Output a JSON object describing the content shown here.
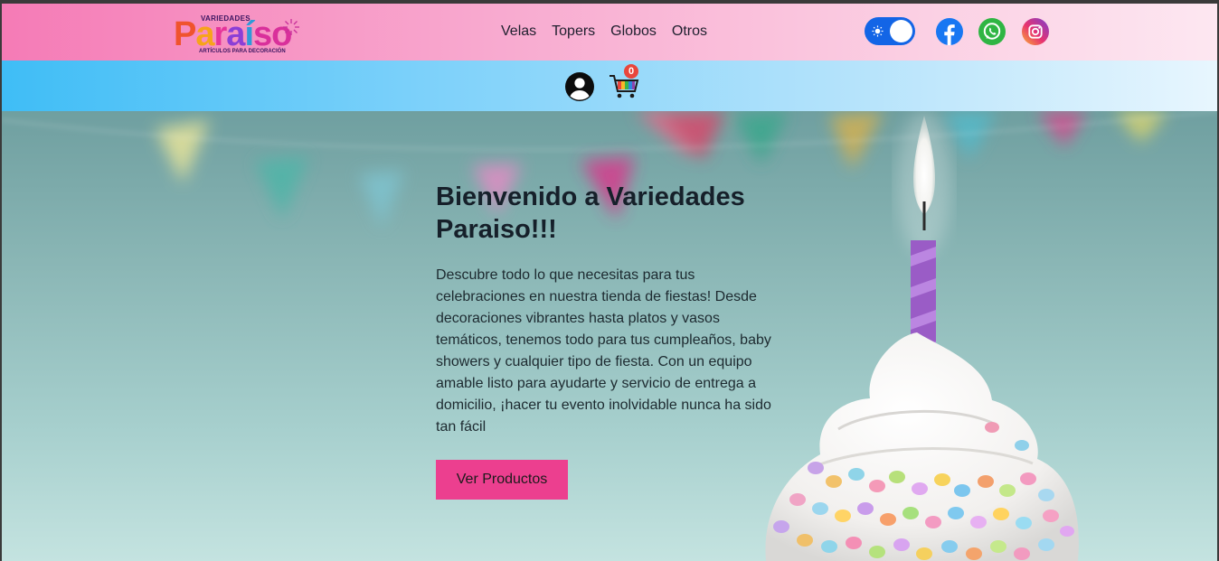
{
  "brand": {
    "top_word": "VARIEDADES",
    "letters": [
      "P",
      "a",
      "r",
      "a",
      "í",
      "so"
    ],
    "tagline": "ARTÍCULOS PARA DECORACIÓN"
  },
  "nav": {
    "items": [
      "Velas",
      "Topers",
      "Globos",
      "Otros"
    ]
  },
  "cart": {
    "count": "0"
  },
  "hero": {
    "title": "Bienvenido a Variedades Paraiso!!!",
    "text": "Descubre todo lo que necesitas para tus celebraciones en nuestra tienda de fiestas! Desde decoraciones vibrantes hasta platos y vasos temáticos, tenemos todo para tus cumpleaños, baby showers y cualquier tipo de fiesta. Con un equipo amable listo para ayudarte y servicio de entrega a domicilio, ¡hacer tu evento inolvidable nunca ha sido tan fácil",
    "button_label": "Ver Productos"
  },
  "icons": {
    "theme_toggle": "sun-icon",
    "social": [
      "facebook-icon",
      "whatsapp-icon",
      "instagram-icon"
    ],
    "user": "user-circle-icon",
    "cart": "shopping-cart-icon"
  },
  "colors": {
    "accent_pink": "#ec3f8f",
    "toggle_blue": "#1365e6",
    "badge_red": "#e8453c"
  }
}
